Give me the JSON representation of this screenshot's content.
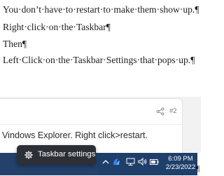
{
  "document": {
    "paragraphs": [
      "You·don’t·have·to·restart·to·make·them·show·up.¶",
      "Right·click·on·the·Taskbar¶",
      "Then¶",
      "Left·Click·on·the·Taskbar·Settings·that·pops·up.¶"
    ],
    "trailing_mark": "¶"
  },
  "post": {
    "number": "#2",
    "text": "Vindows Explorer. Right click>restart.",
    "share_icon": "share-icon"
  },
  "popup": {
    "label": "Taskbar settings",
    "icon": "gear-icon"
  },
  "taskbar": {
    "tray_icons": [
      "chevron-up-icon",
      "app-tray-icon",
      "network-icon",
      "volume-icon",
      "battery-icon"
    ],
    "time": "6:09 PM",
    "date": "2/23/2022"
  },
  "colors": {
    "taskbar": "#1f3f6b",
    "popup": "#2c2f36",
    "accent": "#2f8cff"
  }
}
